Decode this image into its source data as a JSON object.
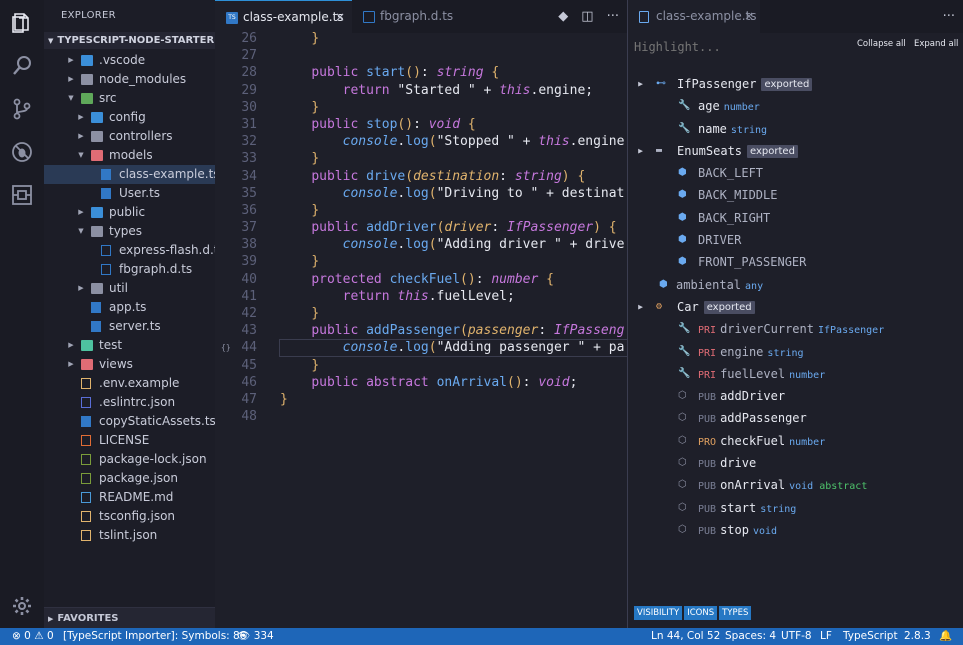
{
  "activity_bar": {
    "icons": [
      "files-icon",
      "search-icon",
      "source-control-icon",
      "debug-icon",
      "extensions-icon",
      "gear-icon"
    ]
  },
  "sidebar": {
    "title": "EXPLORER",
    "project": "TYPESCRIPT-NODE-STARTER",
    "items": [
      {
        "label": ".vscode",
        "kind": "folder",
        "depth": 1,
        "expanded": false,
        "color": "#3b8fd9"
      },
      {
        "label": "node_modules",
        "kind": "folder",
        "depth": 1,
        "expanded": false,
        "color": "#8c90a3"
      },
      {
        "label": "src",
        "kind": "folder",
        "depth": 1,
        "expanded": true,
        "color": "#5fa85a"
      },
      {
        "label": "config",
        "kind": "folder",
        "depth": 2,
        "expanded": false,
        "color": "#3b8fd9"
      },
      {
        "label": "controllers",
        "kind": "folder",
        "depth": 2,
        "expanded": false,
        "color": "#8c90a3"
      },
      {
        "label": "models",
        "kind": "folder",
        "depth": 2,
        "expanded": true,
        "color": "#e06c75"
      },
      {
        "label": "class-example.ts",
        "kind": "ts",
        "depth": 3,
        "selected": true
      },
      {
        "label": "User.ts",
        "kind": "ts",
        "depth": 3
      },
      {
        "label": "public",
        "kind": "folder",
        "depth": 2,
        "expanded": false,
        "color": "#3b8fd9"
      },
      {
        "label": "types",
        "kind": "folder",
        "depth": 2,
        "expanded": true,
        "color": "#8c90a3"
      },
      {
        "label": "express-flash.d.ts",
        "kind": "dts",
        "depth": 3
      },
      {
        "label": "fbgraph.d.ts",
        "kind": "dts",
        "depth": 3
      },
      {
        "label": "util",
        "kind": "folder",
        "depth": 2,
        "expanded": false,
        "color": "#8c90a3"
      },
      {
        "label": "app.ts",
        "kind": "ts",
        "depth": 2
      },
      {
        "label": "server.ts",
        "kind": "ts",
        "depth": 2
      },
      {
        "label": "test",
        "kind": "folder",
        "depth": 1,
        "expanded": false,
        "color": "#4ec2a0"
      },
      {
        "label": "views",
        "kind": "folder",
        "depth": 1,
        "expanded": false,
        "color": "#e06c75"
      },
      {
        "label": ".env.example",
        "kind": "env",
        "depth": 1
      },
      {
        "label": ".eslintrc.json",
        "kind": "eslint",
        "depth": 1
      },
      {
        "label": "copyStaticAssets.ts",
        "kind": "ts",
        "depth": 1
      },
      {
        "label": "LICENSE",
        "kind": "license",
        "depth": 1
      },
      {
        "label": "package-lock.json",
        "kind": "npm",
        "depth": 1
      },
      {
        "label": "package.json",
        "kind": "npm",
        "depth": 1
      },
      {
        "label": "README.md",
        "kind": "md",
        "depth": 1
      },
      {
        "label": "tsconfig.json",
        "kind": "json",
        "depth": 1
      },
      {
        "label": "tslint.json",
        "kind": "json",
        "depth": 1
      }
    ],
    "favorites": "FAVORITES"
  },
  "editor": {
    "tabs": [
      {
        "label": "class-example.ts",
        "active": true,
        "close": "×"
      },
      {
        "label": "fbgraph.d.ts",
        "active": false
      }
    ],
    "actions": [
      "◆",
      "◫",
      "···"
    ],
    "current_line": 44,
    "lines": [
      {
        "n": "26",
        "code": "    }"
      },
      {
        "n": "27",
        "code": ""
      },
      {
        "n": "28",
        "code": "    public start(): string {"
      },
      {
        "n": "29",
        "code": "        return \"Started \" + this.engine;"
      },
      {
        "n": "30",
        "code": "    }"
      },
      {
        "n": "31",
        "code": "    public stop(): void {"
      },
      {
        "n": "32",
        "code": "        console.log(\"Stopped \" + this.engine"
      },
      {
        "n": "33",
        "code": "    }"
      },
      {
        "n": "34",
        "code": "    public drive(destination: string) {"
      },
      {
        "n": "35",
        "code": "        console.log(\"Driving to \" + destinat"
      },
      {
        "n": "36",
        "code": "    }"
      },
      {
        "n": "37",
        "code": "    public addDriver(driver: IfPassenger) {"
      },
      {
        "n": "38",
        "code": "        console.log(\"Adding driver \" + drive"
      },
      {
        "n": "39",
        "code": "    }"
      },
      {
        "n": "40",
        "code": "    protected checkFuel(): number {"
      },
      {
        "n": "41",
        "code": "        return this.fuelLevel;"
      },
      {
        "n": "42",
        "code": "    }"
      },
      {
        "n": "43",
        "code": "    public addPassenger(passenger: IfPasseng"
      },
      {
        "n": "44",
        "code": "        console.log(\"Adding passenger \" + pa"
      },
      {
        "n": "45",
        "code": "    }"
      },
      {
        "n": "46",
        "code": "    public abstract onArrival(): void;"
      },
      {
        "n": "47",
        "code": "}"
      },
      {
        "n": "48",
        "code": ""
      }
    ],
    "gutter_glyph": "{}"
  },
  "outline": {
    "tab": {
      "label": "class-example.ts",
      "close": "×"
    },
    "more": "···",
    "search_placeholder": "Highlight...",
    "collapse_all": "Collapse all",
    "expand_all": "Expand all",
    "items": [
      {
        "depth": 0,
        "twisty": "▲",
        "icon": "interface-icon",
        "glyph": "⊷",
        "glyph_color": "#6aa9ef",
        "name": "IfPassenger",
        "badge": "exported"
      },
      {
        "depth": 1,
        "icon": "wrench-icon",
        "glyph": "🔧",
        "glyph_color": "#c5c8d6",
        "name": "age",
        "type": "number"
      },
      {
        "depth": 1,
        "icon": "wrench-icon",
        "glyph": "🔧",
        "glyph_color": "#c5c8d6",
        "name": "name",
        "type": "string"
      },
      {
        "depth": 0,
        "twisty": "▲",
        "icon": "enum-icon",
        "glyph": "▬",
        "glyph_color": "#aeb2c3",
        "name": "EnumSeats",
        "badge": "exported"
      },
      {
        "depth": 1,
        "icon": "enum-member-icon",
        "glyph": "⬢",
        "glyph_color": "#6aa9ef",
        "name": "BACK_LEFT",
        "dim": true
      },
      {
        "depth": 1,
        "icon": "enum-member-icon",
        "glyph": "⬢",
        "glyph_color": "#6aa9ef",
        "name": "BACK_MIDDLE",
        "dim": true
      },
      {
        "depth": 1,
        "icon": "enum-member-icon",
        "glyph": "⬢",
        "glyph_color": "#6aa9ef",
        "name": "BACK_RIGHT",
        "dim": true
      },
      {
        "depth": 1,
        "icon": "enum-member-icon",
        "glyph": "⬢",
        "glyph_color": "#6aa9ef",
        "name": "DRIVER",
        "dim": true
      },
      {
        "depth": 1,
        "icon": "enum-member-icon",
        "glyph": "⬢",
        "glyph_color": "#6aa9ef",
        "name": "FRONT_PASSENGER",
        "dim": true
      },
      {
        "depth": 0,
        "icon": "variable-icon",
        "glyph": "⬢",
        "glyph_color": "#6aa9ef",
        "name": "ambiental",
        "type": "any",
        "dim": true
      },
      {
        "depth": 0,
        "twisty": "▲",
        "icon": "class-icon",
        "glyph": "⚙",
        "glyph_color": "#e0a060",
        "name": "Car",
        "badge": "exported"
      },
      {
        "depth": 1,
        "icon": "wrench-icon",
        "glyph": "🔧",
        "glyph_color": "#c5c8d6",
        "vis": "PRI",
        "name": "driverCurrent",
        "type": "IfPassenger",
        "dim": true
      },
      {
        "depth": 1,
        "icon": "wrench-icon",
        "glyph": "🔧",
        "glyph_color": "#c5c8d6",
        "vis": "PRI",
        "name": "engine",
        "type": "string",
        "dim": true
      },
      {
        "depth": 1,
        "icon": "wrench-icon",
        "glyph": "🔧",
        "glyph_color": "#c5c8d6",
        "vis": "PRI",
        "name": "fuelLevel",
        "type": "number",
        "dim": true
      },
      {
        "depth": 1,
        "icon": "method-icon",
        "glyph": "⬡",
        "glyph_color": "#8c90a3",
        "vis": "PUB",
        "name": "addDriver"
      },
      {
        "depth": 1,
        "icon": "method-icon",
        "glyph": "⬡",
        "glyph_color": "#8c90a3",
        "vis": "PUB",
        "name": "addPassenger"
      },
      {
        "depth": 1,
        "icon": "method-icon",
        "glyph": "⬡",
        "glyph_color": "#8c90a3",
        "vis": "PRO",
        "name": "checkFuel",
        "type": "number"
      },
      {
        "depth": 1,
        "icon": "method-icon",
        "glyph": "⬡",
        "glyph_color": "#8c90a3",
        "vis": "PUB",
        "name": "drive"
      },
      {
        "depth": 1,
        "icon": "method-icon",
        "glyph": "⬡",
        "glyph_color": "#8c90a3",
        "vis": "PUB",
        "name": "onArrival",
        "type": "void",
        "abstract": "abstract"
      },
      {
        "depth": 1,
        "icon": "method-icon",
        "glyph": "⬡",
        "glyph_color": "#8c90a3",
        "vis": "PUB",
        "name": "start",
        "type": "string"
      },
      {
        "depth": 1,
        "icon": "method-icon",
        "glyph": "⬡",
        "glyph_color": "#8c90a3",
        "vis": "PUB",
        "name": "stop",
        "type": "void"
      }
    ],
    "bottom_buttons": [
      "VISIBILITY",
      "ICONS",
      "TYPES"
    ]
  },
  "statusbar": {
    "errors": "0",
    "warnings": "0",
    "importer": "[TypeScript Importer]: Symbols: 86",
    "views": "334",
    "position": "Ln 44, Col 52",
    "spaces": "Spaces: 4",
    "encoding": "UTF-8",
    "eol": "LF",
    "language": "TypeScript",
    "version": "2.8.3"
  },
  "colors": {
    "accent": "#2e90d8",
    "statusbar": "#1e66b8",
    "ts_icon": "#3178c6"
  }
}
